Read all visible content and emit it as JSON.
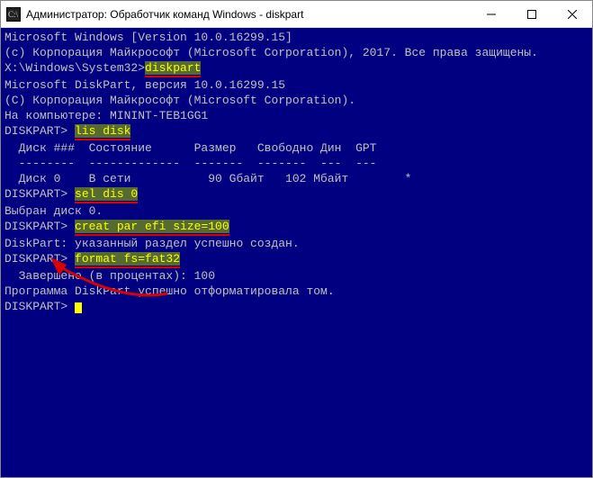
{
  "window": {
    "title": "Администратор: Обработчик команд Windows - diskpart"
  },
  "lines": {
    "l0": "Microsoft Windows [Version 10.0.16299.15]",
    "l1": "(c) Корпорация Майкрософт (Microsoft Corporation), 2017. Все права защищены.",
    "l2": "",
    "prompt1": "X:\\Windows\\System32>",
    "cmd1": "diskpart",
    "l3": "",
    "l4": "Microsoft DiskPart, версия 10.0.16299.15",
    "l5": "",
    "l6": "(C) Корпорация Майкрософт (Microsoft Corporation).",
    "l7": "На компьютере: MININT-TEB1GG1",
    "l8": "",
    "prompt2": "DISKPART> ",
    "cmd2": "lis disk",
    "l9": "",
    "tablehead": "  Диск ###  Состояние      Размер   Свободно Дин  GPT",
    "tablesep": "  --------  -------------  -------  -------  ---  ---",
    "tablerow": "  Диск 0    В сети           90 Gбайт   102 Mбайт        *",
    "l10": "",
    "prompt3": "DISKPART> ",
    "cmd3": "sel dis 0",
    "l11": "",
    "l12": "Выбран диск 0.",
    "l13": "",
    "prompt4": "DISKPART> ",
    "cmd4": "creat par efi size=100",
    "l14": "",
    "l15": "DiskPart: указанный раздел успешно создан.",
    "l16": "",
    "prompt5": "DISKPART> ",
    "cmd5": "format fs=fat32",
    "l17": "",
    "l18": "  Завершено (в процентах): 100",
    "l19": "",
    "l20": "Программа DiskPart успешно отформатировала том.",
    "l21": "",
    "prompt6": "DISKPART> "
  }
}
